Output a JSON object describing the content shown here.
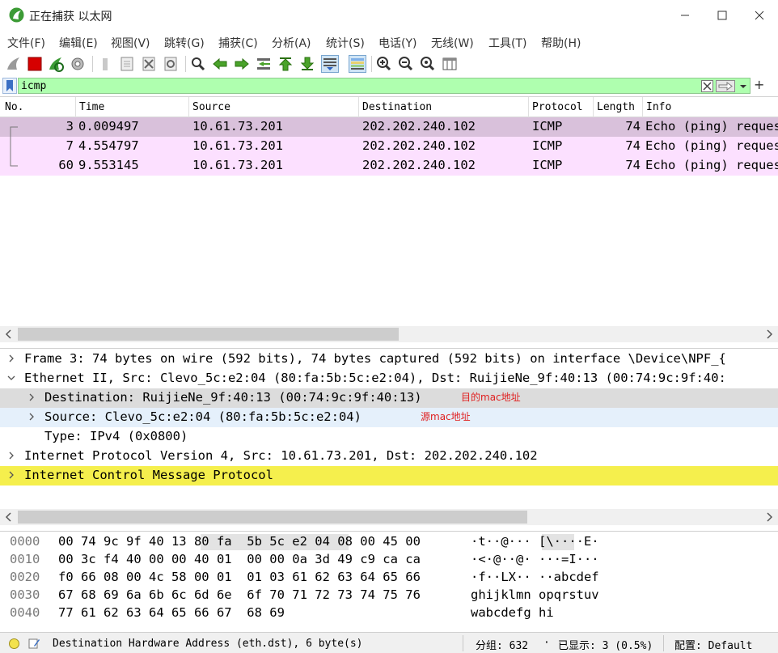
{
  "window": {
    "title": "正在捕获 以太网",
    "accent_color": "#3c9b35"
  },
  "menu": [
    "文件(F)",
    "编辑(E)",
    "视图(V)",
    "跳转(G)",
    "捕获(C)",
    "分析(A)",
    "统计(S)",
    "电话(Y)",
    "无线(W)",
    "工具(T)",
    "帮助(H)"
  ],
  "toolbar": {
    "icons": [
      "shark-fin-start-icon",
      "stop-capture-icon",
      "restart-capture-icon",
      "capture-options-icon",
      "open-file-icon",
      "save-file-icon",
      "close-file-icon",
      "reload-file-icon",
      "find-packet-icon",
      "go-back-icon",
      "go-forward-icon",
      "go-to-packet-icon",
      "go-first-icon",
      "go-last-icon",
      "autoscroll-icon",
      "colorize-icon",
      "zoom-in-icon",
      "zoom-out-icon",
      "zoom-normal-icon",
      "resize-columns-icon"
    ]
  },
  "filter": {
    "value": "icmp",
    "background": "#afffaf"
  },
  "packet_list": {
    "columns": [
      "No.",
      "Time",
      "Source",
      "Destination",
      "Protocol",
      "Length",
      "Info"
    ],
    "rows": [
      {
        "no": "3",
        "time": "0.009497",
        "source": "10.61.73.201",
        "destination": "202.202.240.102",
        "protocol": "ICMP",
        "length": "74",
        "info": "Echo (ping) request",
        "selected": true
      },
      {
        "no": "7",
        "time": "4.554797",
        "source": "10.61.73.201",
        "destination": "202.202.240.102",
        "protocol": "ICMP",
        "length": "74",
        "info": "Echo (ping) request",
        "selected": false
      },
      {
        "no": "60",
        "time": "9.553145",
        "source": "10.61.73.201",
        "destination": "202.202.240.102",
        "protocol": "ICMP",
        "length": "74",
        "info": "Echo (ping) request",
        "selected": false
      }
    ],
    "row_color": "#fce0ff",
    "selected_row_color": "#d9c1db"
  },
  "details": {
    "rows": [
      {
        "text": "Frame 3: 74 bytes on wire (592 bits), 74 bytes captured (592 bits) on interface \\Device\\NPF_{",
        "expanded": false,
        "level": 0
      },
      {
        "text": "Ethernet II, Src: Clevo_5c:e2:04 (80:fa:5b:5c:e2:04), Dst: RuijieNe_9f:40:13 (00:74:9c:9f:40:",
        "expanded": true,
        "level": 0
      },
      {
        "text": "Destination: RuijieNe_9f:40:13 (00:74:9c:9f:40:13)",
        "expanded": false,
        "level": 1
      },
      {
        "text": "Source: Clevo_5c:e2:04 (80:fa:5b:5c:e2:04)",
        "expanded": false,
        "level": 1
      },
      {
        "text": "Type: IPv4 (0x0800)",
        "expanded": null,
        "level": 1
      },
      {
        "text": "Internet Protocol Version 4, Src: 10.61.73.201, Dst: 202.202.240.102",
        "expanded": false,
        "level": 0
      },
      {
        "text": "Internet Control Message Protocol",
        "expanded": false,
        "level": 0
      }
    ],
    "annotations": [
      "目的mac地址",
      "源mac地址"
    ],
    "icmp_highlight_color": "#f5ef4d",
    "selected_color": "#dcdcdc",
    "hover_color": "#e5f0fb"
  },
  "bytes": {
    "rows": [
      {
        "offset": "0000",
        "hex": "00 74 9c 9f 40 13 80 fa  5b 5c e2 04 08 00 45 00",
        "ascii": "·t··@··· [\\····E·"
      },
      {
        "offset": "0010",
        "hex": "00 3c f4 40 00 00 40 01  00 00 0a 3d 49 c9 ca ca",
        "ascii": "·<·@··@· ···=I···"
      },
      {
        "offset": "0020",
        "hex": "f0 66 08 00 4c 58 00 01  01 03 61 62 63 64 65 66",
        "ascii": "·f··LX·· ··abcdef"
      },
      {
        "offset": "0030",
        "hex": "67 68 69 6a 6b 6c 6d 6e  6f 70 71 72 73 74 75 76",
        "ascii": "ghijklmn opqrstuv"
      },
      {
        "offset": "0040",
        "hex": "77 61 62 63 64 65 66 67  68 69",
        "ascii": "wabcdefg hi"
      }
    ]
  },
  "status": {
    "text": "Destination Hardware Address (eth.dst), 6 byte(s)",
    "packets": "分组: 632",
    "displayed": "已显示: 3 (0.5%)",
    "profile": "配置: Default"
  }
}
